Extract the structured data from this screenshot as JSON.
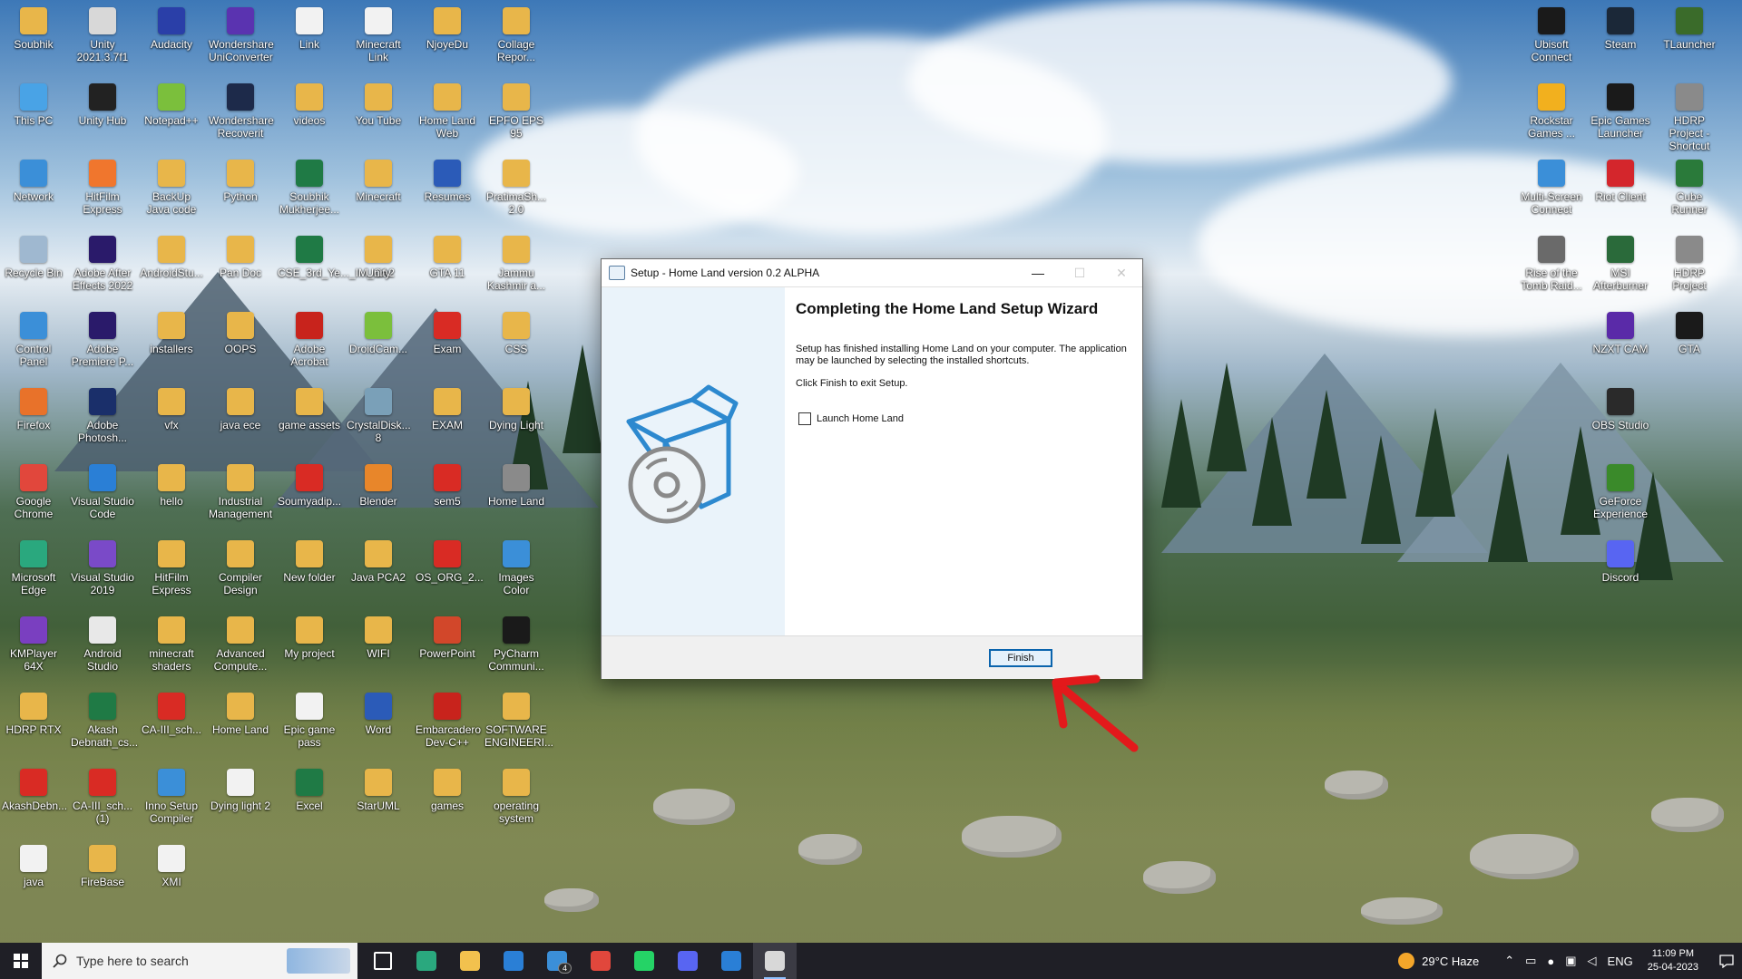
{
  "desktop_icons_left": [
    {
      "label": "Soubhik",
      "color": "#e8b64a"
    },
    {
      "label": "Unity 2021.3.7f1",
      "color": "#d8d8d8"
    },
    {
      "label": "Audacity",
      "color": "#2a3fa8"
    },
    {
      "label": "Wondershare UniConverter",
      "color": "#5a33b0"
    },
    {
      "label": "Link",
      "color": "#f2f2f2"
    },
    {
      "label": "Minecraft Link",
      "color": "#f2f2f2"
    },
    {
      "label": "NjoyeDu",
      "color": "#e8b64a"
    },
    {
      "label": "Collage Repor...",
      "color": "#e8b64a"
    },
    {
      "label": "This PC",
      "color": "#49a3e6"
    },
    {
      "label": "Unity Hub",
      "color": "#222222"
    },
    {
      "label": "Notepad++",
      "color": "#7bbf3c"
    },
    {
      "label": "Wondershare Recoverit",
      "color": "#1d2a4a"
    },
    {
      "label": "videos",
      "color": "#e8b64a"
    },
    {
      "label": "You Tube",
      "color": "#e8b64a"
    },
    {
      "label": "Home Land Web",
      "color": "#e8b64a"
    },
    {
      "label": "EPFO EPS 95",
      "color": "#e8b64a"
    },
    {
      "label": "Network",
      "color": "#3b8fd8"
    },
    {
      "label": "HitFilm Express",
      "color": "#f0762d"
    },
    {
      "label": "BackUp Java code",
      "color": "#e8b64a"
    },
    {
      "label": "Python",
      "color": "#e8b64a"
    },
    {
      "label": "Soubhik Mukherjee...",
      "color": "#1f7a45"
    },
    {
      "label": "Minecraft",
      "color": "#e8b64a"
    },
    {
      "label": "Resumes",
      "color": "#2b5bb8"
    },
    {
      "label": "PratimaSh... 2.0",
      "color": "#e8b64a"
    },
    {
      "label": "Recycle Bin",
      "color": "#9fb8d0"
    },
    {
      "label": "Adobe After Effects 2022",
      "color": "#2a1a6a"
    },
    {
      "label": "AndroidStu...",
      "color": "#e8b64a"
    },
    {
      "label": "Pan Doc",
      "color": "#e8b64a"
    },
    {
      "label": "CSE_3rd_Ye..._IM_CA2",
      "color": "#1f7a45"
    },
    {
      "label": "Unity",
      "color": "#e8b64a"
    },
    {
      "label": "GTA 11",
      "color": "#e8b64a"
    },
    {
      "label": "Jammu Kashmir a...",
      "color": "#e8b64a"
    },
    {
      "label": "Control Panel",
      "color": "#3b8fd8"
    },
    {
      "label": "Adobe Premiere P...",
      "color": "#2a1a6a"
    },
    {
      "label": "installers",
      "color": "#e8b64a"
    },
    {
      "label": "OOPS",
      "color": "#e8b64a"
    },
    {
      "label": "Adobe Acrobat",
      "color": "#c8231c"
    },
    {
      "label": "DroidCam...",
      "color": "#7bbf3c"
    },
    {
      "label": "Exam",
      "color": "#d92b24"
    },
    {
      "label": "CSS",
      "color": "#e8b64a"
    },
    {
      "label": "Firefox",
      "color": "#e8722a"
    },
    {
      "label": "Adobe Photosh...",
      "color": "#1a2f6a"
    },
    {
      "label": "vfx",
      "color": "#e8b64a"
    },
    {
      "label": "java ece",
      "color": "#e8b64a"
    },
    {
      "label": "game assets",
      "color": "#e8b64a"
    },
    {
      "label": "CrystalDisk... 8",
      "color": "#7aa0b8"
    },
    {
      "label": "EXAM",
      "color": "#e8b64a"
    },
    {
      "label": "Dying Light",
      "color": "#e8b64a"
    },
    {
      "label": "Google Chrome",
      "color": "#e1473c"
    },
    {
      "label": "Visual Studio Code",
      "color": "#2a7fd6"
    },
    {
      "label": "hello",
      "color": "#e8b64a"
    },
    {
      "label": "Industrial Management",
      "color": "#e8b64a"
    },
    {
      "label": "Soumyadip...",
      "color": "#d92b24"
    },
    {
      "label": "Blender",
      "color": "#e8862a"
    },
    {
      "label": "sem5",
      "color": "#d92b24"
    },
    {
      "label": "Home Land",
      "color": "#8a8a8a"
    },
    {
      "label": "Microsoft Edge",
      "color": "#2aa87e"
    },
    {
      "label": "Visual Studio 2019",
      "color": "#7a4ac8"
    },
    {
      "label": "HitFilm Express",
      "color": "#e8b64a"
    },
    {
      "label": "Compiler Design",
      "color": "#e8b64a"
    },
    {
      "label": "New folder",
      "color": "#e8b64a"
    },
    {
      "label": "Java PCA2",
      "color": "#e8b64a"
    },
    {
      "label": "OS_ORG_2...",
      "color": "#d92b24"
    },
    {
      "label": "Images Color",
      "color": "#3b8fd8"
    },
    {
      "label": "KMPlayer 64X",
      "color": "#7a3fc0"
    },
    {
      "label": "Android Studio",
      "color": "#e8e8e8"
    },
    {
      "label": "minecraft shaders",
      "color": "#e8b64a"
    },
    {
      "label": "Advanced Compute...",
      "color": "#e8b64a"
    },
    {
      "label": "My project",
      "color": "#e8b64a"
    },
    {
      "label": "WIFI",
      "color": "#e8b64a"
    },
    {
      "label": "PowerPoint",
      "color": "#d2472a"
    },
    {
      "label": "PyCharm Communi...",
      "color": "#1a1a1a"
    },
    {
      "label": "HDRP RTX",
      "color": "#e8b64a"
    },
    {
      "label": "Akash Debnath_cs...",
      "color": "#1f7a45"
    },
    {
      "label": "CA-III_sch...",
      "color": "#d92b24"
    },
    {
      "label": "Home Land",
      "color": "#e8b64a"
    },
    {
      "label": "Epic game pass",
      "color": "#f2f2f2"
    },
    {
      "label": "Word",
      "color": "#2b5bb8"
    },
    {
      "label": "Embarcadero Dev-C++",
      "color": "#c8231c"
    },
    {
      "label": "SOFTWARE ENGINEERI...",
      "color": "#e8b64a"
    },
    {
      "label": "AkashDebn...",
      "color": "#d92b24"
    },
    {
      "label": "CA-III_sch... (1)",
      "color": "#d92b24"
    },
    {
      "label": "Inno Setup Compiler",
      "color": "#3b8fd8"
    },
    {
      "label": "Dying light 2",
      "color": "#f2f2f2"
    },
    {
      "label": "Excel",
      "color": "#1f7a45"
    },
    {
      "label": "StarUML",
      "color": "#e8b64a"
    },
    {
      "label": "games",
      "color": "#e8b64a"
    },
    {
      "label": "operating system",
      "color": "#e8b64a"
    },
    {
      "label": "java",
      "color": "#f2f2f2"
    },
    {
      "label": "FireBase",
      "color": "#e8b64a"
    },
    {
      "label": "XMI",
      "color": "#f2f2f2"
    }
  ],
  "desktop_icons_right": [
    {
      "label": "Ubisoft Connect",
      "color": "#1a1a1a"
    },
    {
      "label": "Steam",
      "color": "#1b2838"
    },
    {
      "label": "TLauncher",
      "color": "#3a6b2a"
    },
    {
      "label": "Rockstar Games ...",
      "color": "#f2b01e"
    },
    {
      "label": "Epic Games Launcher",
      "color": "#1a1a1a"
    },
    {
      "label": "HDRP Project - Shortcut",
      "color": "#8a8a8a"
    },
    {
      "label": "Multi-Screen Connect",
      "color": "#3b8fd8"
    },
    {
      "label": "Riot Client",
      "color": "#d4262c"
    },
    {
      "label": "Cube Runner",
      "color": "#2a7a3a"
    },
    {
      "label": "Rise of the Tomb Raid...",
      "color": "#6a6a6a"
    },
    {
      "label": "MSI Afterburner",
      "color": "#2a6a3a"
    },
    {
      "label": "HDRP Project",
      "color": "#8a8a8a"
    },
    {
      "label": "NZXT CAM",
      "color": "#5a2aa8"
    },
    {
      "label": "GTA",
      "color": "#1a1a1a"
    },
    {
      "label": "OBS Studio",
      "color": "#2a2a2a"
    },
    {
      "label": "GeForce Experience",
      "color": "#3a8a2a"
    },
    {
      "label": "Discord",
      "color": "#5865f2"
    }
  ],
  "window": {
    "title": "Setup - Home Land version 0.2 ALPHA",
    "minimize": "—",
    "maximize": "☐",
    "close": "✕",
    "heading": "Completing the Home Land Setup Wizard",
    "para1": "Setup has finished installing Home Land on your computer. The application may be launched by selecting the installed shortcuts.",
    "para2": "Click Finish to exit Setup.",
    "checkbox_label": "Launch Home Land",
    "checkbox_checked": false,
    "finish_label": "Finish"
  },
  "annotation": {
    "color": "#e3191b"
  },
  "taskbar": {
    "search_placeholder": "Type here to search",
    "apps": [
      {
        "name": "task-view",
        "color": "#ffffff"
      },
      {
        "name": "edge",
        "color": "#2aa87e"
      },
      {
        "name": "file-explorer",
        "color": "#f2c14e"
      },
      {
        "name": "microsoft-store",
        "color": "#2a7fd6"
      },
      {
        "name": "mail",
        "color": "#3b8fd8"
      },
      {
        "name": "chrome",
        "color": "#e1473c"
      },
      {
        "name": "whatsapp",
        "color": "#25d366"
      },
      {
        "name": "discord",
        "color": "#5865f2"
      },
      {
        "name": "vscode",
        "color": "#2a7fd6"
      },
      {
        "name": "setup-installer",
        "color": "#d8d8d8"
      }
    ],
    "mail_badge": "4",
    "weather": "29°C  Haze",
    "language": "ENG",
    "time": "11:09 PM",
    "date": "25-04-2023"
  }
}
